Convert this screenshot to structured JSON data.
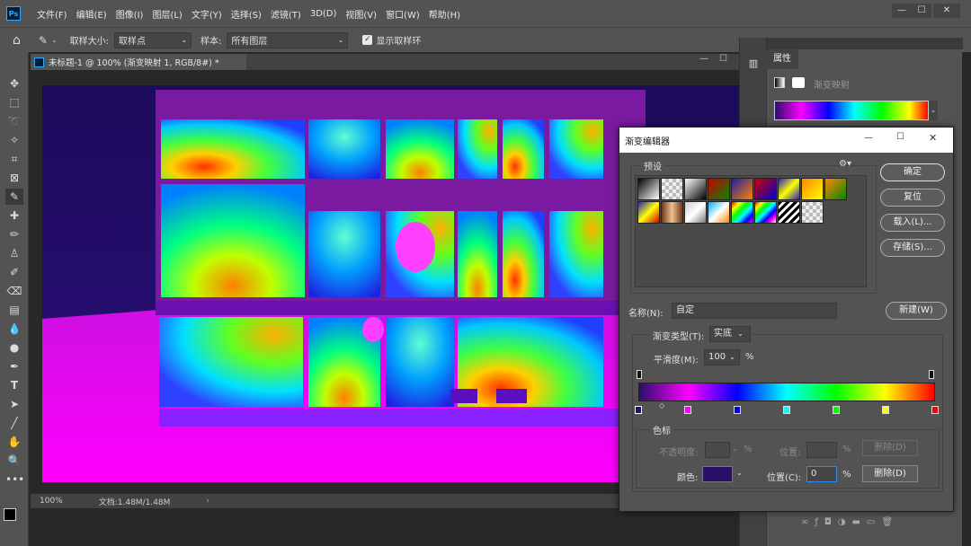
{
  "app": {
    "logo": "Ps"
  },
  "menu": [
    "文件(F)",
    "编辑(E)",
    "图像(I)",
    "图层(L)",
    "文字(Y)",
    "选择(S)",
    "滤镜(T)",
    "3D(D)",
    "视图(V)",
    "窗口(W)",
    "帮助(H)"
  ],
  "options": {
    "sample_size_label": "取样大小:",
    "sample_size_value": "取样点",
    "sample_label": "样本:",
    "sample_value": "所有图层",
    "show_ring_label": "显示取样环"
  },
  "document": {
    "tab_title": "未标题-1 @ 100% (渐变映射 1, RGB/8#) *",
    "zoom": "100%",
    "doc_info": "文档:1.48M/1.48M"
  },
  "properties": {
    "tab_label": "属性",
    "adjustment_label": "渐变映射"
  },
  "gradient_editor": {
    "title": "渐变编辑器",
    "presets_label": "预设",
    "ok_label": "确定",
    "reset_label": "复位",
    "load_label": "载入(L)...",
    "save_label": "存储(S)...",
    "name_label": "名称(N):",
    "name_value": "自定",
    "new_label": "新建(W)",
    "type_label": "渐变类型(T):",
    "type_value": "实底",
    "smoothness_label": "平滑度(M):",
    "smoothness_value": "100",
    "percent": "%",
    "stops_group_label": "色标",
    "opacity_label": "不透明度:",
    "position_label_dim": "位置:",
    "delete_label_dim": "删除(D)",
    "color_label": "颜色:",
    "position_label": "位置(C):",
    "position_value": "0",
    "delete_label": "删除(D)",
    "selected_color": "#2a0f6b",
    "gradient_stops": [
      "#2a0f6b",
      "#ff00ff",
      "#0000ff",
      "#00ffff",
      "#00ff00",
      "#ffff00",
      "#ff0000"
    ]
  }
}
